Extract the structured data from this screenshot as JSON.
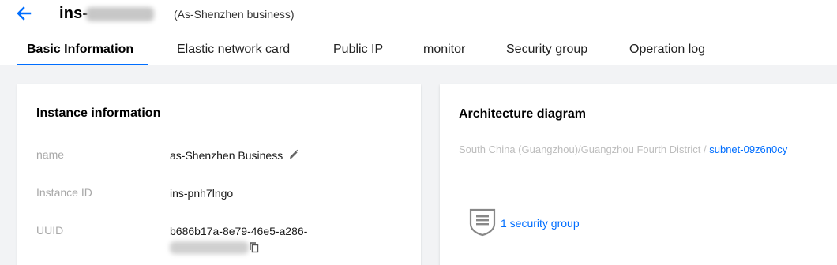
{
  "header": {
    "title": "ins-",
    "subtitle": "(As-Shenzhen business)"
  },
  "tabs": [
    {
      "label": "Basic Information",
      "active": true
    },
    {
      "label": "Elastic network card",
      "active": false
    },
    {
      "label": "Public IP",
      "active": false
    },
    {
      "label": "monitor",
      "active": false
    },
    {
      "label": "Security group",
      "active": false
    },
    {
      "label": "Operation log",
      "active": false
    }
  ],
  "instance": {
    "title": "Instance information",
    "name_label": "name",
    "name_value": "as-Shenzhen Business",
    "id_label": "Instance ID",
    "id_value": "ins-pnh7lngo",
    "uuid_label": "UUID",
    "uuid_value": "b686b17a-8e79-46e5-a286-"
  },
  "architecture": {
    "title": "Architecture diagram",
    "path": "South China (Guangzhou)/Guangzhou Fourth District / ",
    "subnet": "subnet-09z6n0cy",
    "security_group_link": "1 security group"
  },
  "colors": {
    "accent": "#006eff"
  }
}
